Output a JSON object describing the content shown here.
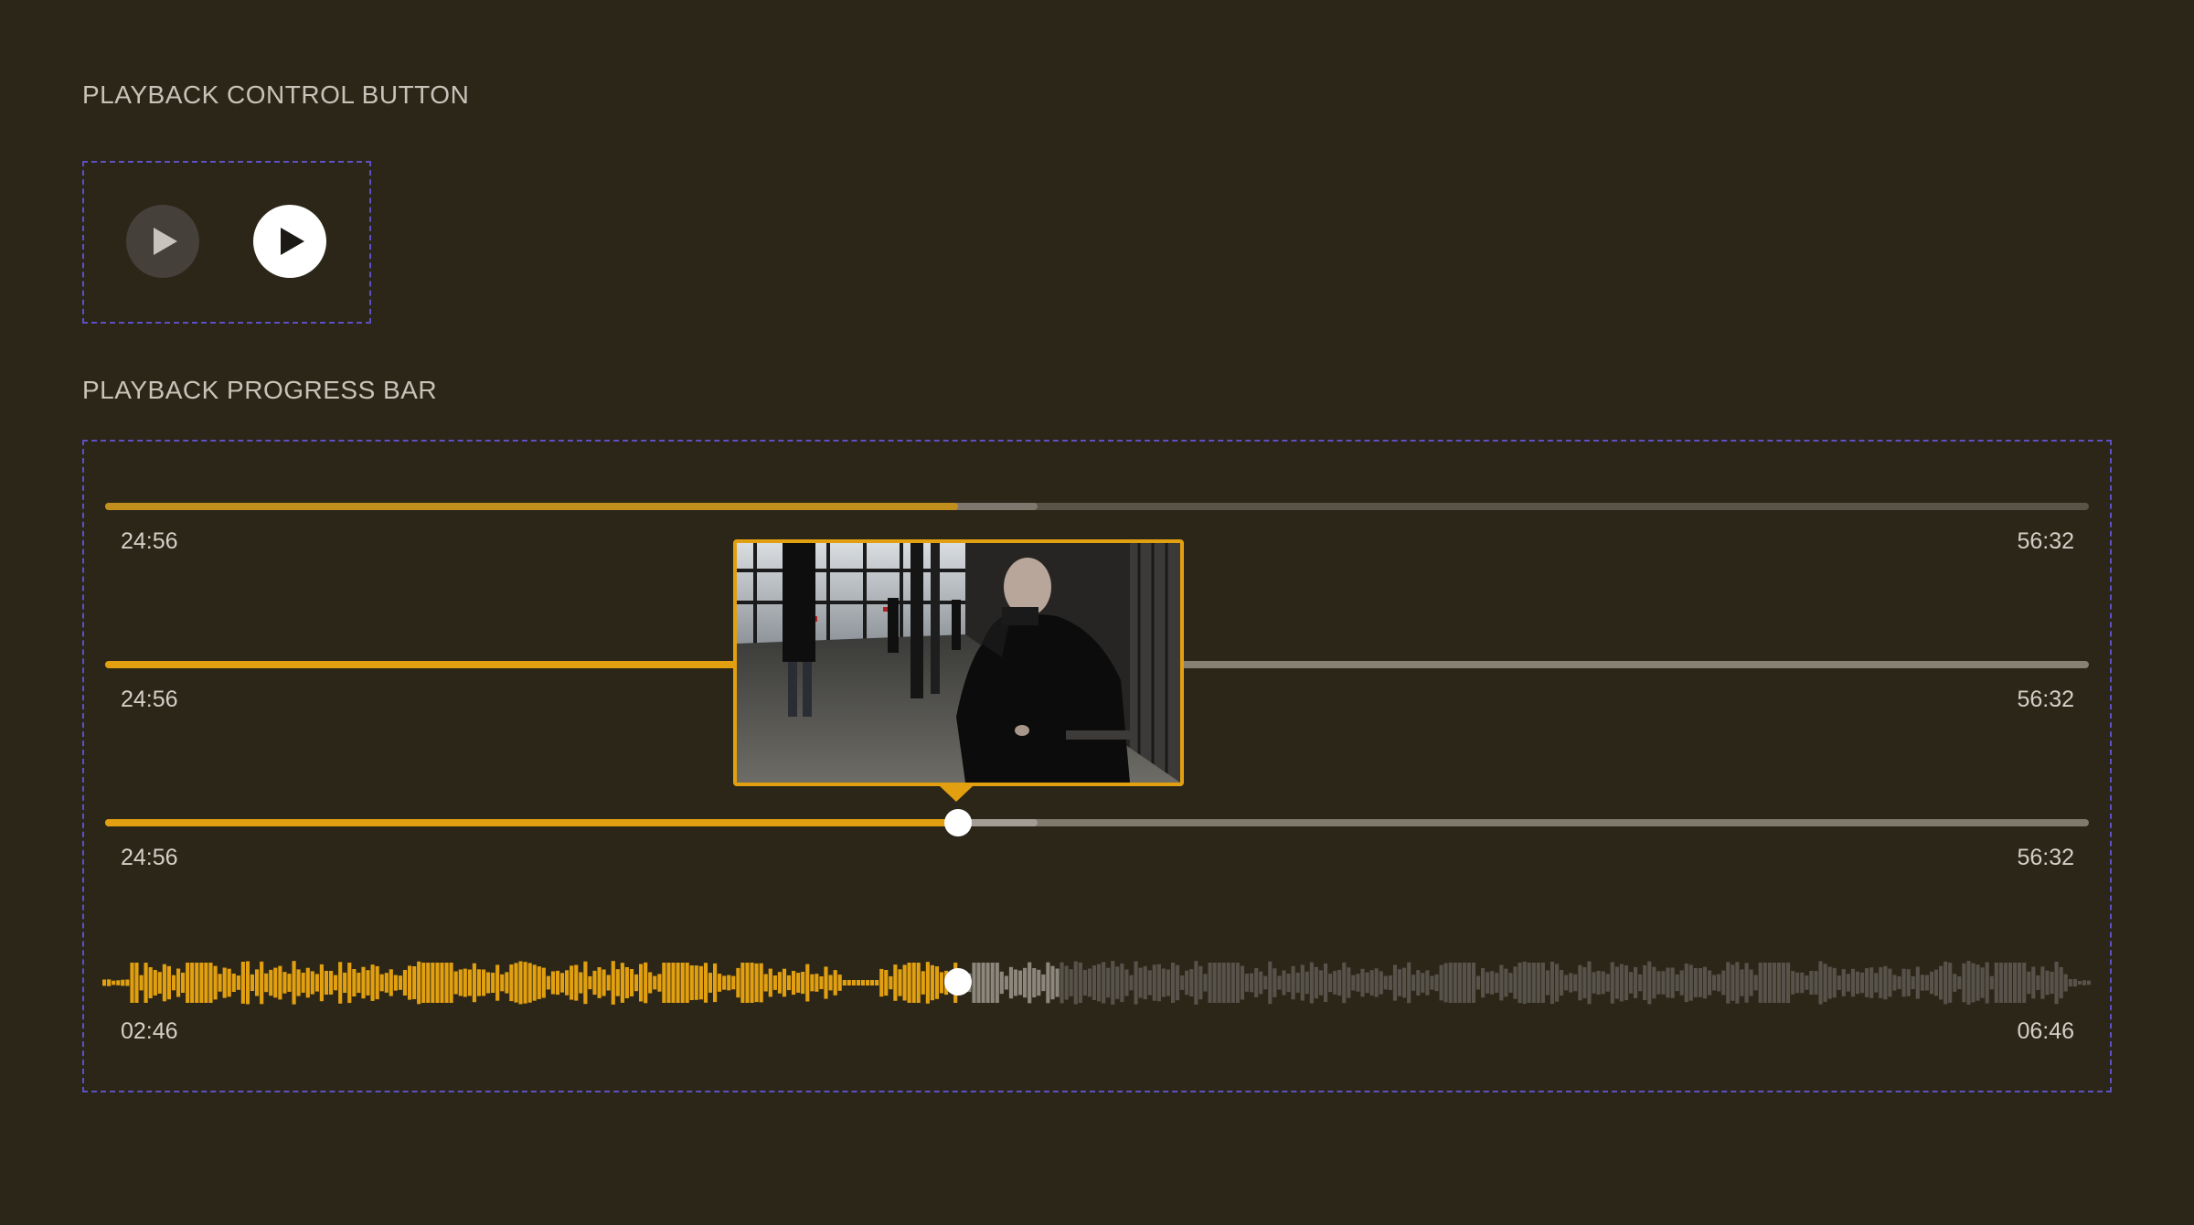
{
  "sections": {
    "buttons_title": "PLAYBACK CONTROL BUTTON",
    "progress_title": "PLAYBACK PROGRESS BAR"
  },
  "buttons": {
    "muted_icon": "play-icon",
    "active_icon": "play-icon"
  },
  "progress_bars": [
    {
      "start_time": "24:56",
      "end_time": "56:32",
      "progress": 0.43,
      "buffered": 0.47
    },
    {
      "start_time": "24:56",
      "end_time": "56:32",
      "progress": 0.43,
      "buffered": 0.43
    },
    {
      "start_time": "24:56",
      "end_time": "56:32",
      "progress": 0.43,
      "buffered": 0.47
    },
    {
      "start_time": "02:46",
      "end_time": "06:46",
      "progress": 0.43,
      "buffered": 0.48
    }
  ],
  "colors": {
    "accent": "#e2a010",
    "background": "#2b2618",
    "track": "#595448",
    "dashed_border": "#5d4fc4"
  }
}
